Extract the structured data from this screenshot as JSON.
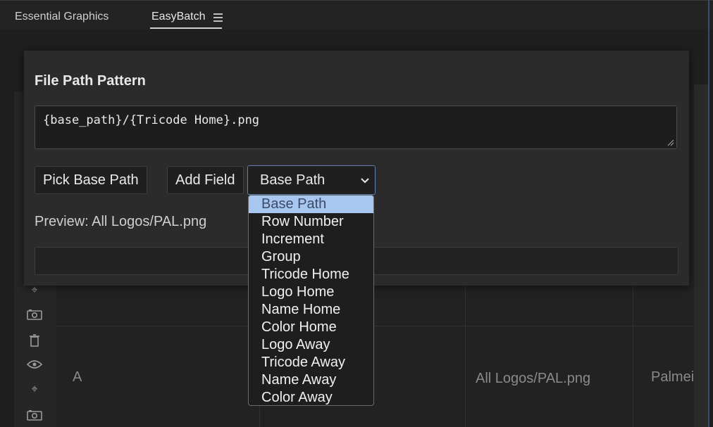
{
  "tabs": [
    {
      "label": "Essential Graphics",
      "active": false
    },
    {
      "label": "EasyBatch",
      "active": true
    }
  ],
  "background": {
    "row_letter": "A",
    "row_path": "All Logos/PAL.png",
    "row_name": "Palmei"
  },
  "modal": {
    "title": "File Path Pattern",
    "path_value": "{base_path}/{Tricode Home}.png",
    "pick_base_path_label": "Pick Base Path",
    "add_field_label": "Add Field",
    "field_select_value": "Base Path",
    "preview_text": "Preview: All Logos/PAL.png"
  },
  "dropdown": {
    "options": [
      "Base Path",
      "Row Number",
      "Increment",
      "Group",
      "Tricode Home",
      "Logo Home",
      "Name Home",
      "Color Home",
      "Logo Away",
      "Tricode Away",
      "Name Away",
      "Color Away"
    ],
    "selected_index": 0
  },
  "colors": {
    "accent_border": "#5f7fb0",
    "selection_bg": "#a7c7f0"
  }
}
